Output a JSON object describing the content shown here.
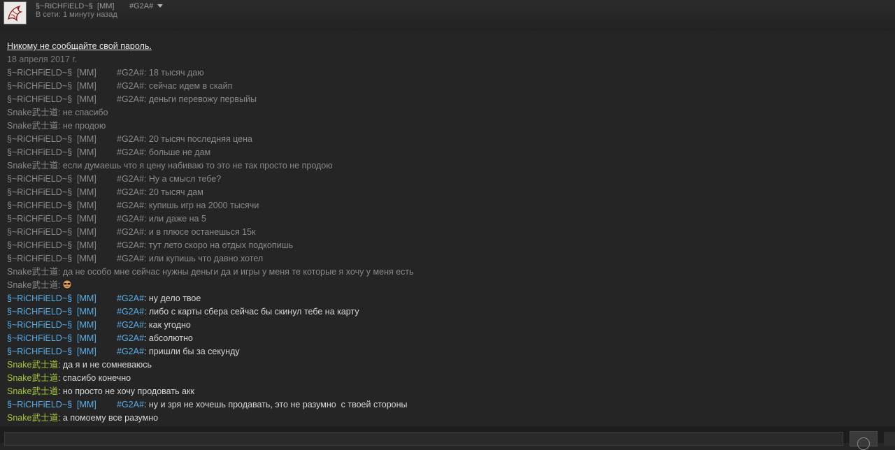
{
  "header": {
    "name": "§~RiCHFiELD~§  [MM]",
    "tag": "#G2A#",
    "status": "В сети: 1 минуту назад"
  },
  "chat": {
    "notice": "Никому не сообщайте свой пароль.",
    "date": "18 апреля 2017 г."
  },
  "names": {
    "richfield_a": "§~RiCHFiELD~§  [MM]",
    "richfield_b": "#G2A#",
    "snake": "Snake武士道"
  },
  "messages": [
    {
      "from": "richfield",
      "state": "old",
      "text": "18 тысяч даю"
    },
    {
      "from": "richfield",
      "state": "old",
      "text": "сейчас идем в скайп"
    },
    {
      "from": "richfield",
      "state": "old",
      "text": "деньги перевожу первыйы"
    },
    {
      "from": "snake",
      "state": "old",
      "text": "не спасибо"
    },
    {
      "from": "snake",
      "state": "old",
      "text": "не продою"
    },
    {
      "from": "richfield",
      "state": "old",
      "text": "20 тысяч последняя цена"
    },
    {
      "from": "richfield",
      "state": "old",
      "text": "больше не дам"
    },
    {
      "from": "snake",
      "state": "old",
      "text": "если думаешь что я цену набиваю то это не так просто не продою"
    },
    {
      "from": "richfield",
      "state": "old",
      "text": "Ну а смысл тебе?"
    },
    {
      "from": "richfield",
      "state": "old",
      "text": "20 тысяч дам"
    },
    {
      "from": "richfield",
      "state": "old",
      "text": "купишь игр на 2000 тысячи"
    },
    {
      "from": "richfield",
      "state": "old",
      "text": "или даже на 5"
    },
    {
      "from": "richfield",
      "state": "old",
      "text": "и в плюсе останешься 15к"
    },
    {
      "from": "richfield",
      "state": "old",
      "text": "тут лето скоро на отдых подкопишь"
    },
    {
      "from": "richfield",
      "state": "old",
      "text": "или купишь что давно хотел"
    },
    {
      "from": "snake",
      "state": "old",
      "text": "да не особо мне сейчас нужны деньги да и игры у меня те которые я хочу у меня есть"
    },
    {
      "from": "snake",
      "state": "old",
      "text": "",
      "emoji": "sunglasses-emoji"
    },
    {
      "from": "richfield",
      "state": "new",
      "text": "ну дело твое"
    },
    {
      "from": "richfield",
      "state": "new",
      "text": "либо с карты сбера сейчас бы скинул тебе на карту"
    },
    {
      "from": "richfield",
      "state": "new",
      "text": "как угодно"
    },
    {
      "from": "richfield",
      "state": "new",
      "text": "абсолютно"
    },
    {
      "from": "richfield",
      "state": "new",
      "text": "пришли бы за секунду"
    },
    {
      "from": "snake",
      "state": "new",
      "text": "да я и не сомневаюсь"
    },
    {
      "from": "snake",
      "state": "new",
      "text": "спасибо конечно"
    },
    {
      "from": "snake",
      "state": "new",
      "text": "но просто не хочу продовать акк"
    },
    {
      "from": "richfield",
      "state": "new",
      "text": "ну и зря не хочешь продавать, это не разумно  с твоей стороны"
    },
    {
      "from": "snake",
      "state": "new",
      "text": "а помоему все разумно"
    }
  ],
  "colors": {
    "richfield_new": "#5aaee8",
    "snake_new": "#a4c83a",
    "old": "#8a8a8a"
  },
  "icons": {
    "avatar": "avatar-dragon-image",
    "dropdown": "chevron-down-icon",
    "send": "send-icon"
  }
}
